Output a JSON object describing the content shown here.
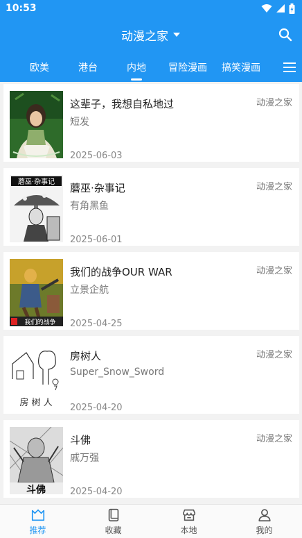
{
  "status": {
    "time": "10:53"
  },
  "header": {
    "title": "动漫之家"
  },
  "tabs": [
    {
      "label": "欧美",
      "active": false
    },
    {
      "label": "港台",
      "active": false
    },
    {
      "label": "内地",
      "active": true
    },
    {
      "label": "冒险漫画",
      "active": false
    },
    {
      "label": "搞笑漫画",
      "active": false
    }
  ],
  "comics": [
    {
      "title": "这辈子，我想自私地过",
      "author": "短发",
      "date": "2025-06-03",
      "source": "动漫之家"
    },
    {
      "title": "蘑巫·杂事记",
      "author": "有角黑鱼",
      "date": "2025-06-01",
      "source": "动漫之家",
      "cover_text": "蘑巫·杂事记"
    },
    {
      "title": "我们的战争OUR WAR",
      "author": "立景企航",
      "date": "2025-04-25",
      "source": "动漫之家",
      "cover_text": "我们的战争"
    },
    {
      "title": "房树人",
      "author": "Super_Snow_Sword",
      "date": "2025-04-20",
      "source": "动漫之家",
      "cover_text": "房 树 人"
    },
    {
      "title": "斗佛",
      "author": "戚万强",
      "date": "2025-04-20",
      "source": "动漫之家",
      "cover_text": "斗佛"
    }
  ],
  "bottom_nav": [
    {
      "label": "推荐",
      "icon": "recommend-icon",
      "active": true
    },
    {
      "label": "收藏",
      "icon": "bookshelf-icon",
      "active": false
    },
    {
      "label": "本地",
      "icon": "store-icon",
      "active": false
    },
    {
      "label": "我的",
      "icon": "profile-icon",
      "active": false
    }
  ],
  "colors": {
    "primary": "#2196f3",
    "background": "#f2f2f2"
  }
}
